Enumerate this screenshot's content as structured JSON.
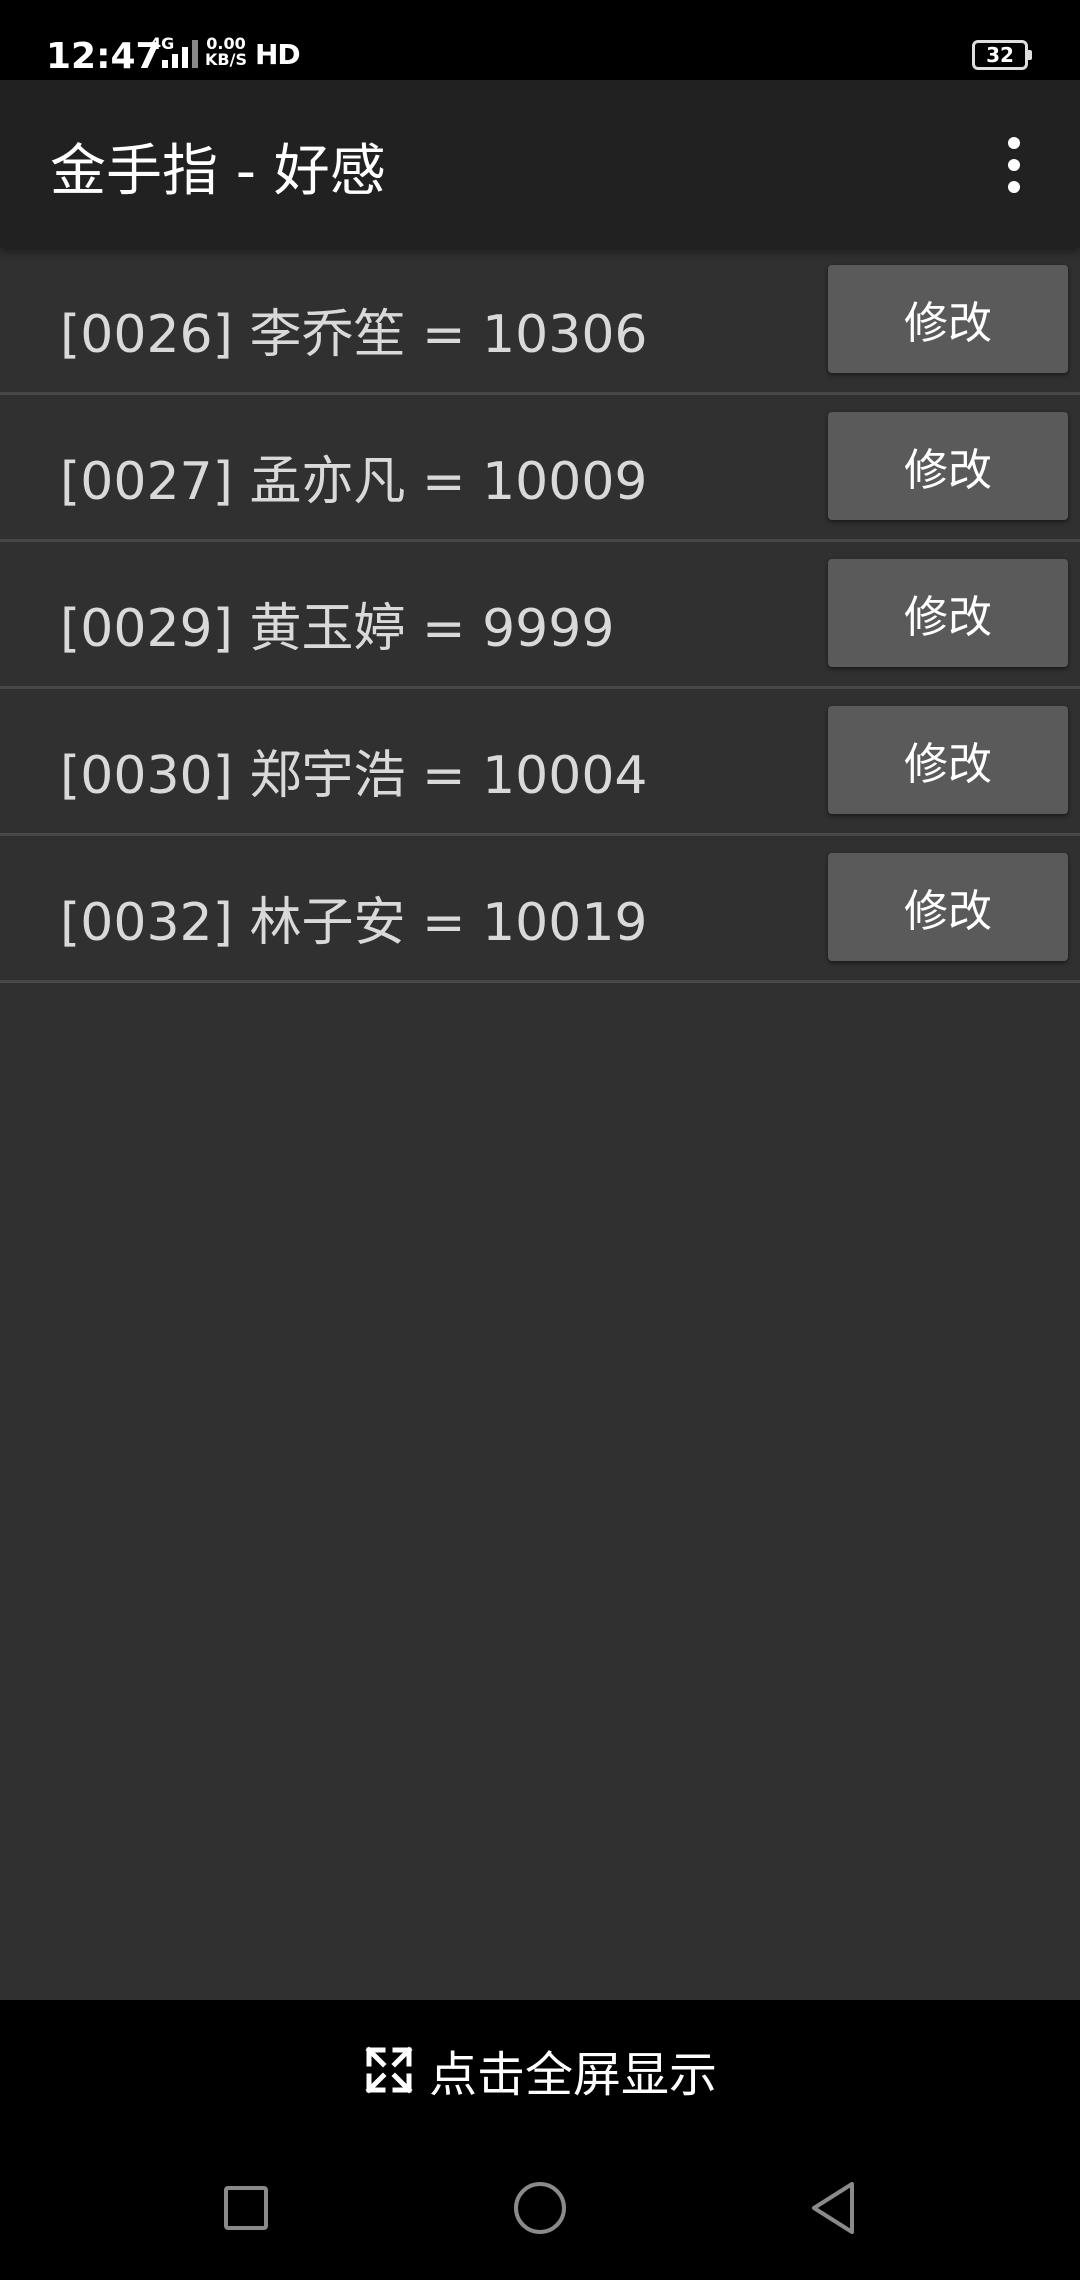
{
  "status_bar": {
    "time": "12:47",
    "network": "4G",
    "speed_value": "0.00",
    "speed_unit": "KB/S",
    "hd": "HD",
    "battery": "32"
  },
  "app_bar": {
    "title": "金手指 - 好感",
    "menu_icon": "more-vert-icon"
  },
  "list": {
    "items": [
      {
        "text": "[0026] 李乔笙 = 10306",
        "button": "修改"
      },
      {
        "text": "[0027] 孟亦凡 = 10009",
        "button": "修改"
      },
      {
        "text": "[0029] 黄玉婷 = 9999",
        "button": "修改"
      },
      {
        "text": "[0030] 郑宇浩 = 10004",
        "button": "修改"
      },
      {
        "text": "[0032] 林子安 = 10019",
        "button": "修改"
      }
    ]
  },
  "fullscreen": {
    "label": "点击全屏显示",
    "icon": "fullscreen-icon"
  },
  "nav_bar": {
    "recent_icon": "recent-apps-icon",
    "home_icon": "home-icon",
    "back_icon": "back-icon"
  },
  "colors": {
    "background": "#303030",
    "app_bar": "#212121",
    "button": "#5a5a5a",
    "divider": "#474747",
    "text": "#d9d9d9"
  }
}
